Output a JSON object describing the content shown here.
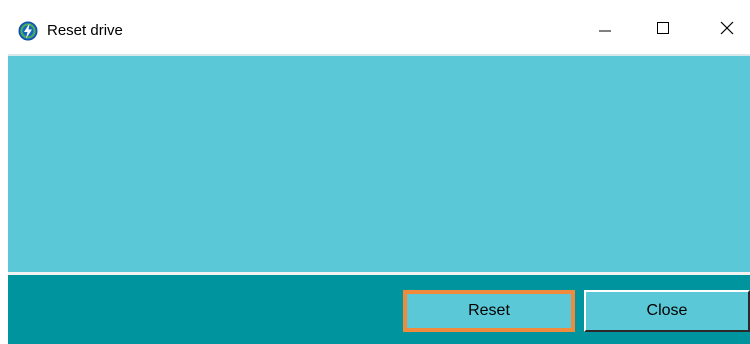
{
  "window": {
    "title": "Reset drive",
    "icon": "lightning-bolt-icon",
    "controls": {
      "minimize": "minimize-icon",
      "maximize": "maximize-icon",
      "close": "close-icon"
    }
  },
  "footer": {
    "reset_label": "Reset",
    "close_label": "Close"
  },
  "colors": {
    "content_bg": "#5bc8d7",
    "footer_bg": "#00949e",
    "focus_border": "#f08a3c"
  }
}
